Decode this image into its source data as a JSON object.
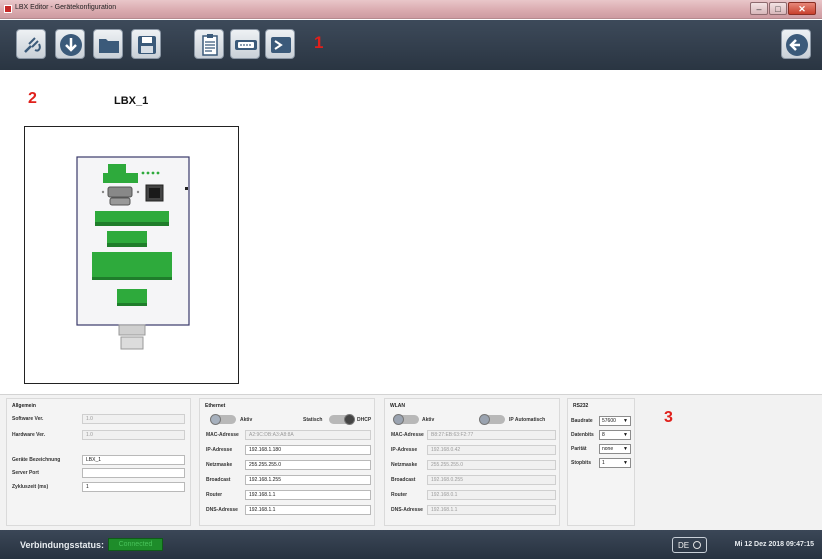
{
  "window": {
    "title": "LBX Editor - Gerätekonfiguration",
    "controls": {
      "minimize": "–",
      "maximize": "□",
      "close": "✕"
    }
  },
  "toolbar": {
    "buttons": [
      {
        "icon": "plug-icon"
      },
      {
        "icon": "download-icon"
      },
      {
        "icon": "folder-icon"
      },
      {
        "icon": "save-icon"
      },
      {
        "icon": "clipboard-list-icon"
      },
      {
        "icon": "serial-port-icon"
      },
      {
        "icon": "terminal-icon"
      },
      {
        "icon": "back-arrow-icon"
      }
    ],
    "marker": "1"
  },
  "main": {
    "marker": "2",
    "device_name": "LBX_1"
  },
  "config": {
    "marker": "3",
    "allgemein": {
      "title": "Allgemein",
      "software_label": "Software Ver.",
      "software_value": "1.0",
      "hardware_label": "Hardware Ver.",
      "hardware_value": "1.0",
      "bezeichnung_label": "Geräte Bezeichnung",
      "bezeichnung_value": "LBX_1",
      "server_port_label": "Server Port",
      "server_port_value": "",
      "zykluszeit_label": "Zykluszeit (ms)",
      "zykluszeit_value": "1"
    },
    "ethernet": {
      "title": "Ethernet",
      "aktiv_label": "Aktiv",
      "statisch_label": "Statisch",
      "dhcp_label": "DHCP",
      "mac_label": "MAC-Adresse",
      "mac_value": "A2:9C:DB:A3:A8:8A",
      "ip_label": "IP-Adresse",
      "ip_value": "192.168.1.180",
      "netzmaske_label": "Netzmaske",
      "netzmaske_value": "255.255.255.0",
      "broadcast_label": "Broadcast",
      "broadcast_value": "192.168.1.255",
      "router_label": "Router",
      "router_value": "192.168.1.1",
      "dns_label": "DNS-Adresse",
      "dns_value": "192.168.1.1"
    },
    "wlan": {
      "title": "WLAN",
      "aktiv_label": "Aktiv",
      "ip_auto_label": "IP Automatisch",
      "mac_label": "MAC-Adresse",
      "mac_value": "B8:27:EB:63:F2:77",
      "ip_label": "IP-Adresse",
      "ip_value": "192.168.0.42",
      "netzmaske_label": "Netzmaske",
      "netzmaske_value": "255.255.255.0",
      "broadcast_label": "Broadcast",
      "broadcast_value": "192.168.0.255",
      "router_label": "Router",
      "router_value": "192.168.0.1",
      "dns_label": "DNS-Adresse",
      "dns_value": "192.168.1.1"
    },
    "rs232": {
      "title": "RS232",
      "baudrate_label": "Baudrate",
      "baudrate_value": "57600",
      "datenbits_label": "Datenbits",
      "datenbits_value": "8",
      "paritaet_label": "Parität",
      "paritaet_value": "none",
      "stopbits_label": "Stopbits",
      "stopbits_value": "1"
    }
  },
  "statusbar": {
    "label": "Verbindungsstatus:",
    "status": "Connected",
    "language": "DE",
    "datetime": "Mi 12 Dez 2018 09:47:15"
  },
  "colors": {
    "toolbar": "#2f3b4a",
    "marker": "#e0201b",
    "status_ok": "#1e8c2a",
    "terminal_green": "#2eaa3c"
  }
}
